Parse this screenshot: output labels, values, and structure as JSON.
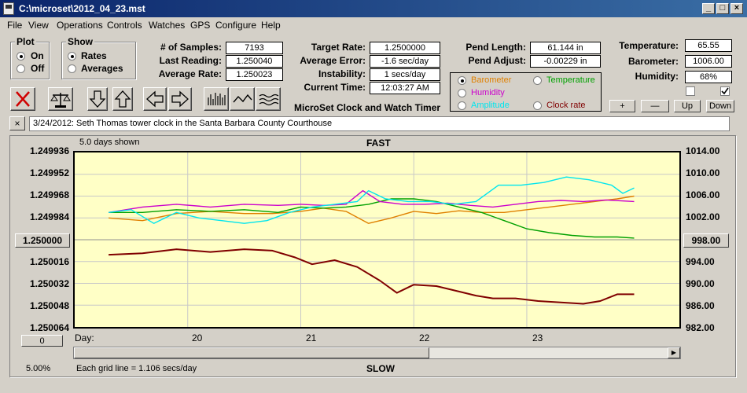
{
  "window": {
    "title": "C:\\microset\\2012_04_23.mst"
  },
  "menu": [
    "File",
    "View",
    "Operations",
    "Controls",
    "Watches",
    "GPS",
    "Configure",
    "Help"
  ],
  "plot_group": {
    "title": "Plot",
    "on": "On",
    "off": "Off",
    "selected": "On"
  },
  "show_group": {
    "title": "Show",
    "rates": "Rates",
    "averages": "Averages",
    "selected": "Rates"
  },
  "stats": {
    "samples_label": "# of Samples:",
    "samples": "7193",
    "last_label": "Last Reading:",
    "last": "1.250040",
    "avg_label": "Average Rate:",
    "avg": "1.250023",
    "target_label": "Target Rate:",
    "target": "1.2500000",
    "avg_err_label": "Average Error:",
    "avg_err": "-1.6 sec/day",
    "instab_label": "Instability:",
    "instab": "1 secs/day",
    "time_label": "Current Time:",
    "time": "12:03:27 AM",
    "pend_len_label": "Pend Length:",
    "pend_len": "61.144 in",
    "pend_adj_label": "Pend Adjust:",
    "pend_adj": "-0.00229 in",
    "temp_label": "Temperature:",
    "temp": "65.55",
    "baro_label": "Barometer:",
    "baro": "1006.00",
    "hum_label": "Humidity:",
    "hum": "68%"
  },
  "sensor_choice": {
    "barometer": "Barometer",
    "temperature": "Temperature",
    "humidity": "Humidity",
    "amplitude": "Amplitude",
    "clock_rate": "Clock rate",
    "selected": "Barometer"
  },
  "colors": {
    "barometer": "#e08000",
    "temperature": "#00a000",
    "humidity": "#cc00cc",
    "amplitude": "#00e5ee",
    "clock_rate": "#800000",
    "rate_line": "#800000"
  },
  "heading": "MicroSet Clock and Watch Timer",
  "buttons": {
    "plus": "+",
    "minus": "—",
    "up": "Up",
    "down": "Down",
    "left_offset": "1.250000",
    "right_offset": "998.00",
    "bottom_left": "0"
  },
  "toolbar_icons": [
    "close-icon",
    "balance-scale-icon",
    "arrow-down-icon",
    "arrow-up-icon",
    "arrow-left-icon",
    "arrow-right-icon",
    "bar-chart-icon",
    "wave-icon",
    "multi-wave-icon"
  ],
  "note": "3/24/2012: Seth Thomas tower clock in the Santa Barbara County Courthouse",
  "chart_data": {
    "type": "line",
    "title": "FAST",
    "bottom_title": "SLOW",
    "days_shown": "5.0 days shown",
    "x_label": "Day:",
    "x_ticks": [
      "20",
      "21",
      "22",
      "23"
    ],
    "y_left_ticks": [
      "1.249936",
      "1.249952",
      "1.249968",
      "1.249984",
      "1.250000",
      "1.250016",
      "1.250032",
      "1.250048",
      "1.250064"
    ],
    "y_right_ticks": [
      "1014.00",
      "1010.00",
      "1006.00",
      "1002.00",
      "998.00",
      "994.00",
      "990.00",
      "986.00",
      "982.00"
    ],
    "ylim_left": [
      1.249936,
      1.250064
    ],
    "ylim_right": [
      982,
      1014
    ],
    "grid_note": "Each grid line = 1.106 secs/day",
    "zoom": "5.00%",
    "series": [
      {
        "name": "Clock rate",
        "color": "#800000",
        "x": [
          19.3,
          19.6,
          19.9,
          20.2,
          20.5,
          20.75,
          20.95,
          21.1,
          21.3,
          21.5,
          21.7,
          21.85,
          22.0,
          22.2,
          22.4,
          22.55,
          22.7,
          22.9,
          23.1,
          23.3,
          23.5,
          23.65,
          23.8,
          23.95
        ],
        "y": [
          1.250011,
          1.25001,
          1.250007,
          1.250009,
          1.250007,
          1.250008,
          1.250013,
          1.250018,
          1.250015,
          1.25002,
          1.25003,
          1.250039,
          1.250033,
          1.250034,
          1.250038,
          1.250041,
          1.250043,
          1.250043,
          1.250045,
          1.250046,
          1.250047,
          1.250045,
          1.25004,
          1.25004
        ]
      },
      {
        "name": "Barometer",
        "color": "#e08000",
        "x": [
          19.3,
          19.6,
          19.9,
          20.2,
          20.5,
          20.75,
          21.0,
          21.2,
          21.4,
          21.6,
          21.8,
          22.0,
          22.2,
          22.4,
          22.6,
          22.8,
          23.0,
          23.2,
          23.4,
          23.6,
          23.8,
          23.95
        ],
        "y": [
          1002.0,
          1001.5,
          1002.8,
          1003.2,
          1002.8,
          1002.8,
          1003.2,
          1003.8,
          1003.2,
          1001.0,
          1002.0,
          1003.2,
          1002.8,
          1003.3,
          1003.0,
          1003.0,
          1003.5,
          1004.0,
          1004.5,
          1005.0,
          1005.5,
          1006.0
        ]
      },
      {
        "name": "Temperature",
        "color": "#00a000",
        "x": [
          19.3,
          19.6,
          19.9,
          20.2,
          20.5,
          20.8,
          21.0,
          21.2,
          21.4,
          21.6,
          21.8,
          22.0,
          22.2,
          22.4,
          22.6,
          22.8,
          23.0,
          23.2,
          23.4,
          23.6,
          23.8,
          23.95
        ],
        "y": [
          1003.0,
          1003.0,
          1003.5,
          1003.2,
          1003.5,
          1003.0,
          1004.0,
          1003.8,
          1004.0,
          1004.5,
          1005.5,
          1005.5,
          1005.0,
          1004.0,
          1003.0,
          1001.5,
          1000.0,
          999.3,
          998.8,
          998.5,
          998.5,
          998.3
        ]
      },
      {
        "name": "Humidity",
        "color": "#cc00cc",
        "x": [
          19.3,
          19.6,
          19.9,
          20.2,
          20.5,
          20.8,
          21.0,
          21.2,
          21.4,
          21.55,
          21.7,
          21.9,
          22.1,
          22.3,
          22.5,
          22.7,
          22.9,
          23.1,
          23.3,
          23.5,
          23.7,
          23.95
        ],
        "y": [
          1003.0,
          1004.0,
          1004.5,
          1004.0,
          1004.5,
          1004.3,
          1004.5,
          1004.3,
          1004.5,
          1007.0,
          1005.0,
          1004.5,
          1004.5,
          1004.7,
          1004.3,
          1004.0,
          1004.5,
          1005.0,
          1005.2,
          1005.0,
          1005.3,
          1005.0
        ]
      },
      {
        "name": "Amplitude",
        "color": "#00e5ee",
        "x": [
          19.3,
          19.5,
          19.7,
          19.9,
          20.1,
          20.3,
          20.5,
          20.7,
          20.9,
          21.1,
          21.3,
          21.5,
          21.6,
          21.75,
          21.95,
          22.15,
          22.35,
          22.55,
          22.75,
          22.95,
          23.15,
          23.35,
          23.55,
          23.75,
          23.85,
          23.95
        ],
        "y": [
          1003.0,
          1003.5,
          1001.0,
          1003.0,
          1002.0,
          1001.5,
          1001.0,
          1001.5,
          1003.0,
          1004.0,
          1004.5,
          1005.0,
          1007.0,
          1005.5,
          1005.0,
          1005.0,
          1004.5,
          1005.0,
          1008.0,
          1008.0,
          1008.5,
          1009.5,
          1009.0,
          1008.0,
          1006.5,
          1007.5
        ]
      }
    ]
  },
  "scrollbar": {
    "left_arrow": "◀",
    "right_arrow": "▶"
  }
}
